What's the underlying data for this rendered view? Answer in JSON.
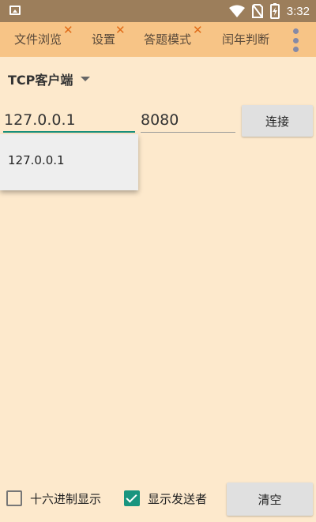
{
  "status_bar": {
    "time": "3:32",
    "battery_glyph": "⚡"
  },
  "tabs": [
    {
      "label": "文件浏览",
      "close": "✕"
    },
    {
      "label": "设置",
      "close": "✕"
    },
    {
      "label": "答题模式",
      "close": "✕"
    },
    {
      "label": "闰年判断"
    }
  ],
  "mode_spinner": {
    "selected": "TCP客户端"
  },
  "ip_input": {
    "value": "127.0.0.1"
  },
  "port_input": {
    "value": "8080"
  },
  "connect_button": {
    "label": "连接"
  },
  "suggestion_dropdown": {
    "items": [
      "127.0.0.1"
    ]
  },
  "hex_display": {
    "label": "十六进制显示",
    "checked": false
  },
  "show_sender": {
    "label": "显示发送者",
    "checked": true
  },
  "clear_button": {
    "label": "清空"
  },
  "colors": {
    "status_bar": "#9c7e5b",
    "tab_bar": "#f7c486",
    "background": "#fde9cc",
    "accent": "#19957f",
    "close_x": "#e06a16"
  }
}
